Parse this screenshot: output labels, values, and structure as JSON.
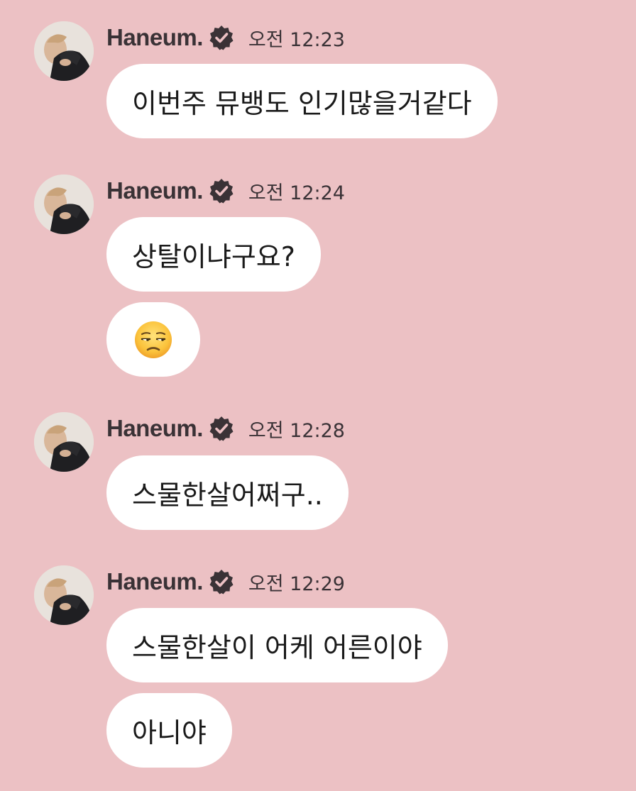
{
  "groups": [
    {
      "name": "Haneum.",
      "time": "오전 12:23",
      "messages": [
        "이번주 뮤뱅도 인기많을거같다"
      ]
    },
    {
      "name": "Haneum.",
      "time": "오전 12:24",
      "messages": [
        "상탈이냐구요?",
        "😒"
      ]
    },
    {
      "name": "Haneum.",
      "time": "오전 12:28",
      "messages": [
        "스물한살어쩌구.."
      ]
    },
    {
      "name": "Haneum.",
      "time": "오전 12:29",
      "messages": [
        "스물한살이 어케 어른이야",
        "아니야"
      ]
    }
  ],
  "icons": {
    "verified": "verified-badge-icon",
    "emoji": "unamused-face"
  },
  "colors": {
    "background": "#ecc1c4",
    "bubble": "#ffffff",
    "text": "#3a3236"
  }
}
